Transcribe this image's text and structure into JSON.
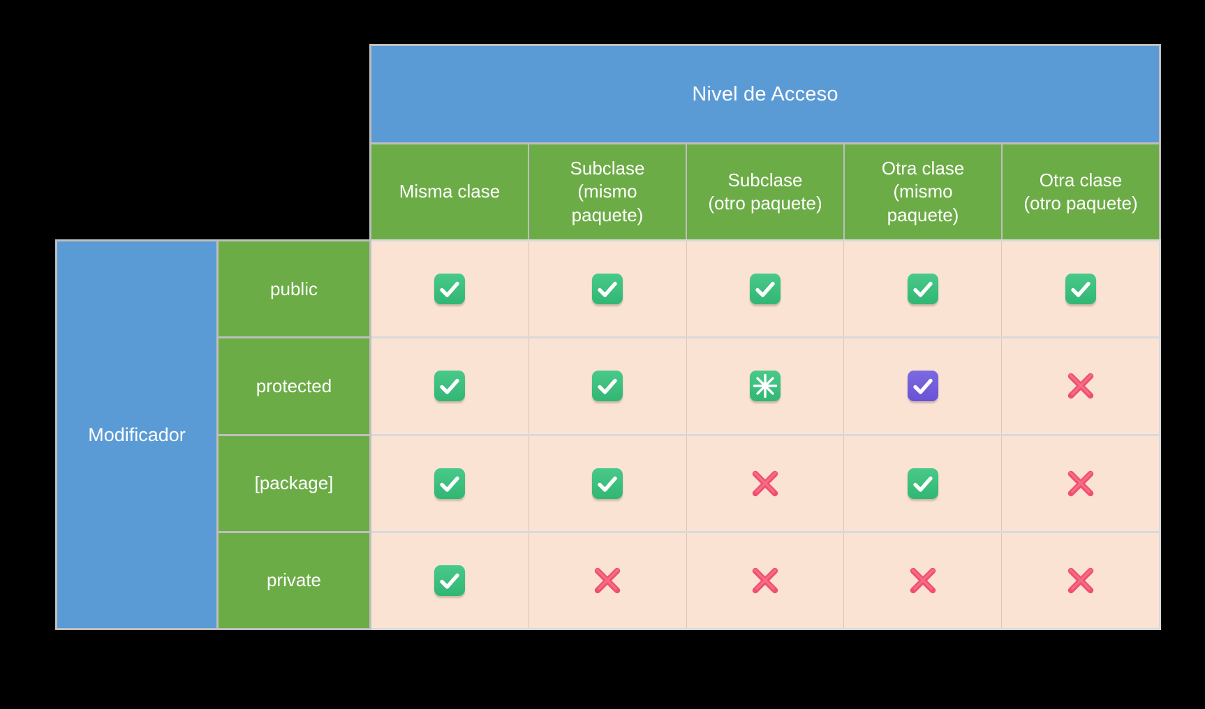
{
  "title": "Nivel de Acceso",
  "row_header_title": "Modificador",
  "colors": {
    "header_blue": "#5B9BD5",
    "header_green": "#6CAC47",
    "cell_background": "#FBE3D3",
    "grid_gray": "#BFBFBF",
    "check_green": "#3ABF7E",
    "check_purple": "#6F59D9",
    "cross_pink": "#F04E6E",
    "page_background": "#000000"
  },
  "columns": [
    "Misma clase",
    "Subclase\n(mismo\npaquete)",
    "Subclase\n(otro paquete)",
    "Otra clase\n(mismo\npaquete)",
    "Otra clase\n(otro paquete)"
  ],
  "rows": [
    {
      "modifier": "public",
      "cells": [
        "check-green",
        "check-green",
        "check-green",
        "check-green",
        "check-green"
      ]
    },
    {
      "modifier": "protected",
      "cells": [
        "check-green",
        "check-green",
        "asterisk-green",
        "check-purple",
        "cross-pink"
      ]
    },
    {
      "modifier": "[package]",
      "cells": [
        "check-green",
        "check-green",
        "cross-pink",
        "check-green",
        "cross-pink"
      ]
    },
    {
      "modifier": "private",
      "cells": [
        "check-green",
        "cross-pink",
        "cross-pink",
        "cross-pink",
        "cross-pink"
      ]
    }
  ],
  "icon_legend": {
    "check-green": "green-check-icon",
    "check-purple": "purple-check-icon",
    "asterisk-green": "green-asterisk-icon",
    "cross-pink": "pink-cross-icon"
  }
}
